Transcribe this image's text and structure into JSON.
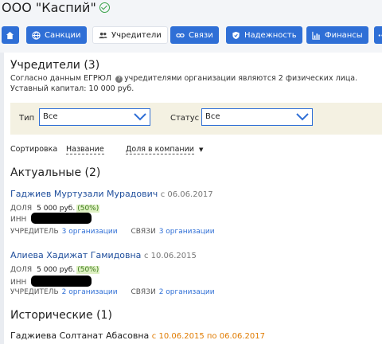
{
  "company": {
    "name": "ООО \"Каспий\""
  },
  "tabs": [
    {
      "label": "",
      "icon": "home-icon"
    },
    {
      "label": "Санкции",
      "icon": "globe-icon"
    },
    {
      "label": "Учредители",
      "icon": "users-icon"
    },
    {
      "label": "Связи",
      "icon": "link-icon"
    },
    {
      "label": "Надежность",
      "icon": "shield-icon"
    },
    {
      "label": "Финансы",
      "icon": "chart-icon"
    },
    {
      "label": "",
      "icon": "more-icon"
    }
  ],
  "founders": {
    "title": "Учредители (3)",
    "desc_before": "Согласно данным ЕГРЮЛ",
    "desc_after": "учредителями организации являются 2 физических лица.",
    "capital": "Уставный капитал: 10 000 руб."
  },
  "filter": {
    "type_label": "Тип",
    "type_value": "Все",
    "status_label": "Статус",
    "status_value": "Все"
  },
  "sort": {
    "label": "Сортировка",
    "by_name": "Название",
    "by_share": "Доля в компании"
  },
  "actual": {
    "title": "Актуальные (2)",
    "persons": [
      {
        "name": "Гаджиев Муртузали Мурадович",
        "date": "с 06.06.2017",
        "share_label": "ДОЛЯ",
        "share_value": "5 000 руб.",
        "share_pct": "(50%)",
        "inn_label": "ИНН",
        "founder_label": "УЧРЕДИТЕЛЬ",
        "founder_link": "3 организации",
        "links_label": "СВЯЗИ",
        "links_link": "3 организации"
      },
      {
        "name": "Алиева Хадижат Гамидовна",
        "date": "с 10.06.2015",
        "share_label": "ДОЛЯ",
        "share_value": "5 000 руб.",
        "share_pct": "(50%)",
        "inn_label": "ИНН",
        "founder_label": "УЧРЕДИТЕЛЬ",
        "founder_link": "2 организации",
        "links_label": "СВЯЗИ",
        "links_link": "2 организации"
      }
    ]
  },
  "historic": {
    "title": "Исторические (1)",
    "persons": [
      {
        "name": "Гаджиева Солтанат Абасовна",
        "date": "с 10.06.2015 по 06.06.2017"
      }
    ]
  },
  "colors": {
    "accent": "#2f6fd6",
    "link": "#1f4e9c",
    "verified": "#3aa34a",
    "history_date": "#e07b00",
    "filter_bg": "#f4f1e2"
  }
}
